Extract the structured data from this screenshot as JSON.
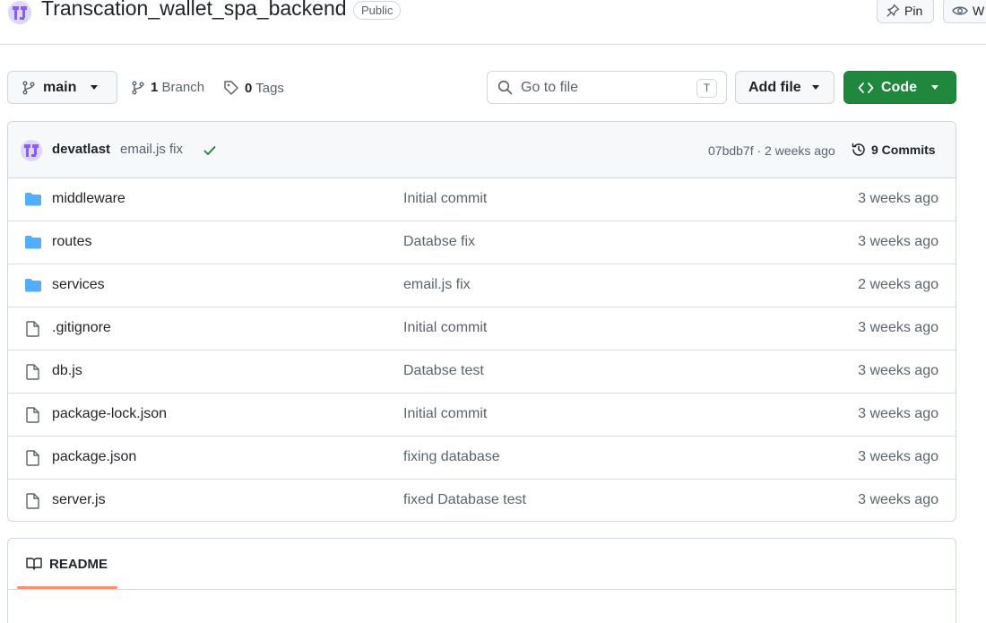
{
  "repo": {
    "name": "Transcation_wallet_spa_backend",
    "visibility": "Public",
    "pin_label": "Pin",
    "watch_label": "W"
  },
  "toolbar": {
    "branch": "main",
    "branch_count": "1",
    "branch_label": "Branch",
    "tag_count": "0",
    "tag_label": "Tags",
    "search_placeholder": "Go to file",
    "search_shortcut": "T",
    "add_file_label": "Add file",
    "code_label": "Code"
  },
  "latest_commit": {
    "author": "devatlast",
    "message": "email.js fix",
    "status": "success",
    "hash_age": "07bdb7f · 2 weeks ago",
    "commits_count_label": "9 Commits"
  },
  "files": [
    {
      "type": "folder",
      "name": "middleware",
      "commit": "Initial commit",
      "age": "3 weeks ago"
    },
    {
      "type": "folder",
      "name": "routes",
      "commit": "Databse fix",
      "age": "3 weeks ago"
    },
    {
      "type": "folder",
      "name": "services",
      "commit": "email.js fix",
      "age": "2 weeks ago"
    },
    {
      "type": "file",
      "name": ".gitignore",
      "commit": "Initial commit",
      "age": "3 weeks ago"
    },
    {
      "type": "file",
      "name": "db.js",
      "commit": "Databse test",
      "age": "3 weeks ago"
    },
    {
      "type": "file",
      "name": "package-lock.json",
      "commit": "Initial commit",
      "age": "3 weeks ago"
    },
    {
      "type": "file",
      "name": "package.json",
      "commit": "fixing database",
      "age": "3 weeks ago"
    },
    {
      "type": "file",
      "name": "server.js",
      "commit": "fixed Database test",
      "age": "3 weeks ago"
    }
  ],
  "readme": {
    "tab_label": "README"
  },
  "colors": {
    "code_button": "#1f883d",
    "folder_icon": "#54aeff",
    "check": "#1a7f37",
    "readme_underline": "#fd8c73",
    "avatar": "#8b5cf6"
  }
}
